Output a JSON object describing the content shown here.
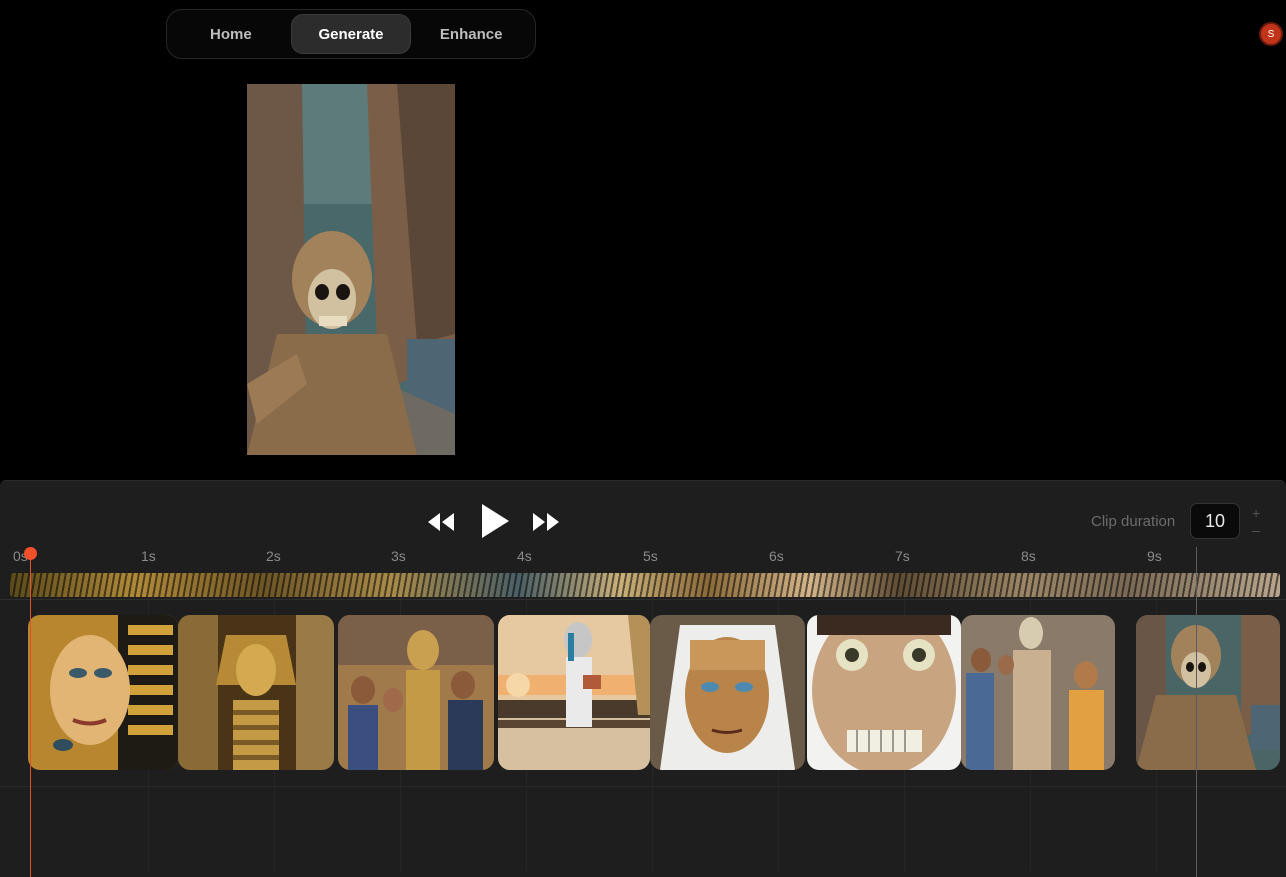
{
  "nav": {
    "tabs": [
      {
        "label": "Home",
        "active": false
      },
      {
        "label": "Generate",
        "active": true
      },
      {
        "label": "Enhance",
        "active": false
      }
    ]
  },
  "user": {
    "avatar_initial": "S",
    "avatar_color": "#c0341a"
  },
  "player": {
    "controls": [
      "rewind-icon",
      "play-icon",
      "fast-forward-icon"
    ],
    "clip_duration_label": "Clip duration",
    "clip_duration_value": "10",
    "increment_label": "+",
    "decrement_label": "–"
  },
  "timeline": {
    "ticks": [
      "0s",
      "1s",
      "2s",
      "3s",
      "4s",
      "5s",
      "6s",
      "7s",
      "8s",
      "9s"
    ],
    "playhead_seconds": 0,
    "accent_color": "#f0502a",
    "clips": [
      {
        "name": "pharaoh-woman-portrait"
      },
      {
        "name": "golden-pharaoh-statue"
      },
      {
        "name": "golden-mummy-in-crowd"
      },
      {
        "name": "mummy-reading-on-bench"
      },
      {
        "name": "mummy-face-white-hood"
      },
      {
        "name": "mummy-face-closeup"
      },
      {
        "name": "mummy-walking-in-crowd"
      },
      {
        "name": "mummy-city-street"
      }
    ]
  }
}
